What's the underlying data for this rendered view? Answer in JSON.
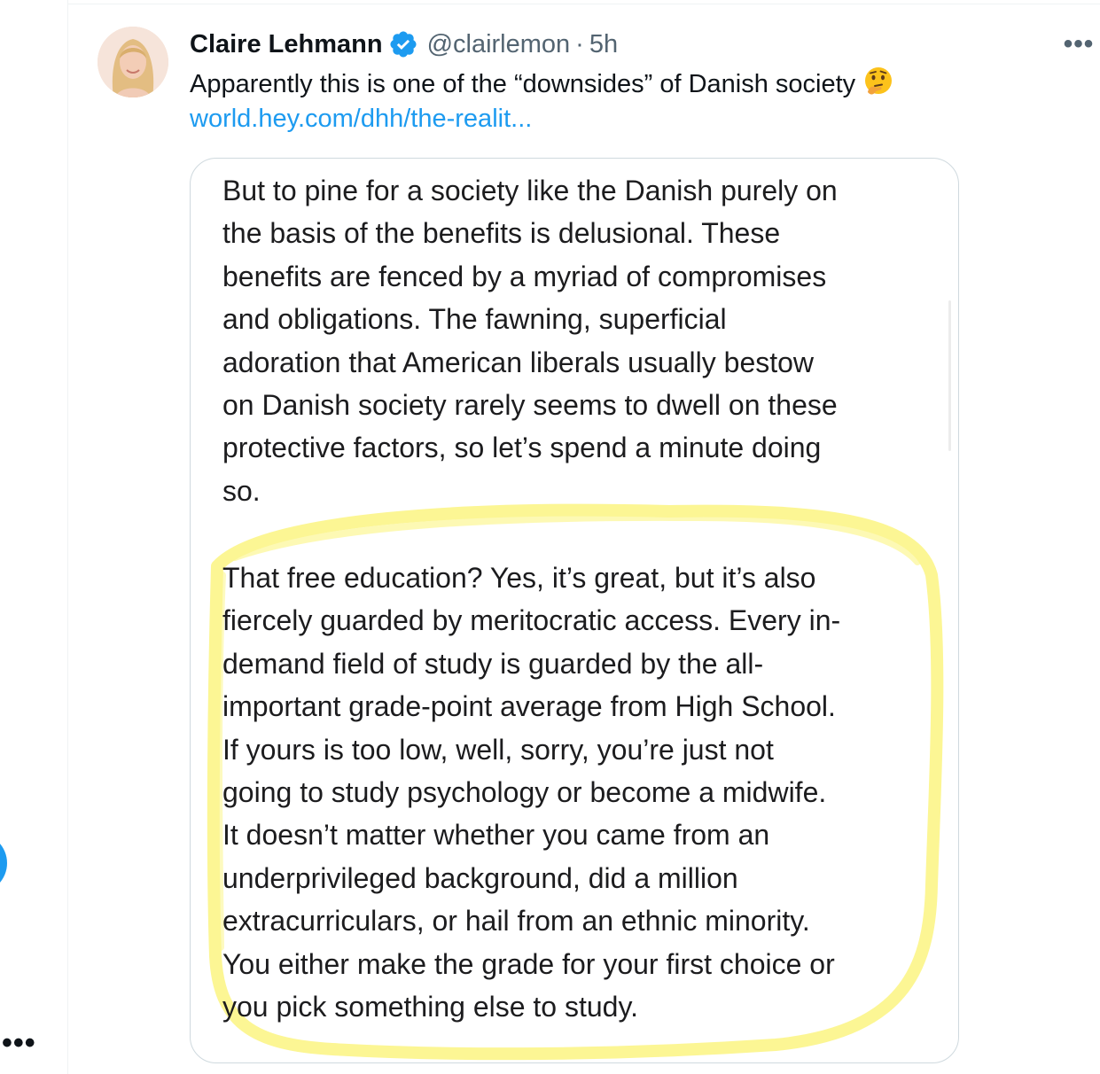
{
  "tweet": {
    "author_name": "Claire Lehmann",
    "handle": "@clairlemon",
    "separator": "·",
    "time": "5h",
    "more_label": "•••",
    "text": "Apparently this is one of the “downsides” of Danish society",
    "emoji": "thinking-face",
    "link_text": "world.hey.com/dhh/the-realit..."
  },
  "sidebar": {
    "more_label": "•••"
  },
  "media": {
    "paragraph1": [
      "But to pine for a society like the Danish purely on",
      "the basis of the benefits is delusional. These",
      "benefits are fenced by a myriad of compromises",
      "and obligations. The fawning, superficial",
      "adoration that American liberals usually bestow",
      "on Danish society rarely seems to dwell on these",
      "protective factors, so let’s spend a minute doing",
      "so."
    ],
    "paragraph2": [
      "That free education? Yes, it’s great, but it’s also",
      "fiercely guarded by meritocratic access. Every in-",
      "demand field of study is guarded by the all-",
      "important grade-point average from High School.",
      "If yours is too low, well, sorry, you’re just not",
      "going to study psychology or become a midwife.",
      "It doesn’t matter whether you came from an",
      "underprivileged background, did a million",
      "extracurriculars, or hail from an ethnic minority.",
      "You either make the grade for your first choice or",
      "you pick something else to study."
    ],
    "highlight_color": "#fdf88a"
  },
  "colors": {
    "accent": "#1d9bf0",
    "secondary_text": "#536471",
    "border": "#cfd9de"
  }
}
